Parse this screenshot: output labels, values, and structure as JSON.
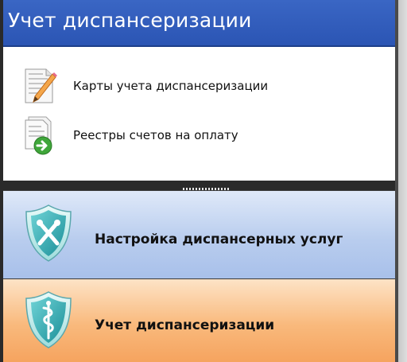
{
  "header": {
    "title": "Учет диспансеризации"
  },
  "menu": {
    "items": [
      {
        "label": "Карты учета диспансеризации",
        "icon": "document-pencil-icon"
      },
      {
        "label": "Реестры счетов на оплату",
        "icon": "document-arrow-icon"
      }
    ]
  },
  "nav": {
    "buttons": [
      {
        "label": "Настройка диспансерных услуг",
        "icon": "shield-tools-icon",
        "color": "#b9cdee"
      },
      {
        "label": "Учет диспансеризации",
        "icon": "shield-medical-icon",
        "color": "#f9b97c"
      }
    ]
  },
  "colors": {
    "header": "#2b55b4",
    "accent_blue": "#b9cdee",
    "accent_orange": "#f9b97c"
  }
}
